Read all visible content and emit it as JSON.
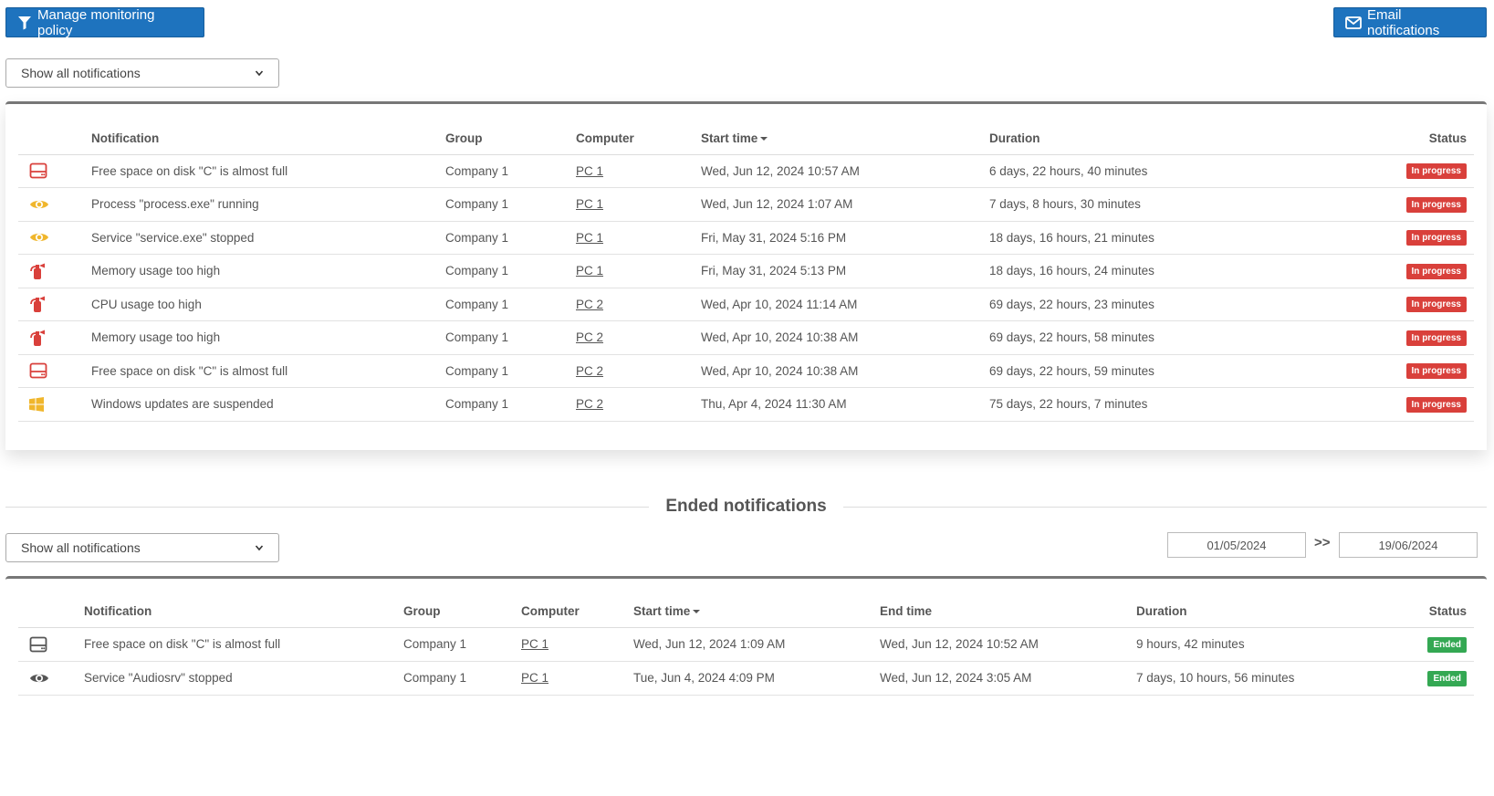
{
  "toolbar": {
    "manage_label": "Manage monitoring policy",
    "email_label": "Email notifications"
  },
  "active": {
    "filter": "Show all notifications",
    "columns": {
      "notification": "Notification",
      "group": "Group",
      "computer": "Computer",
      "start_time": "Start time",
      "duration": "Duration",
      "status": "Status"
    },
    "rows": [
      {
        "icon": "disk-icon",
        "notification": "Free space on disk \"C\" is almost full",
        "group": "Company 1",
        "computer": "PC 1",
        "start_time": "Wed, Jun 12, 2024 10:57 AM",
        "duration": "6 days, 22 hours, 40 minutes",
        "status": "In progress"
      },
      {
        "icon": "eye-icon",
        "notification": "Process \"process.exe\" running",
        "group": "Company 1",
        "computer": "PC 1",
        "start_time": "Wed, Jun 12, 2024 1:07 AM",
        "duration": "7 days, 8 hours, 30 minutes",
        "status": "In progress"
      },
      {
        "icon": "eye-icon",
        "notification": "Service \"service.exe\" stopped",
        "group": "Company 1",
        "computer": "PC 1",
        "start_time": "Fri, May 31, 2024 5:16 PM",
        "duration": "18 days, 16 hours, 21 minutes",
        "status": "In progress"
      },
      {
        "icon": "fire-extinguisher-icon",
        "notification": "Memory usage too high",
        "group": "Company 1",
        "computer": "PC 1",
        "start_time": "Fri, May 31, 2024 5:13 PM",
        "duration": "18 days, 16 hours, 24 minutes",
        "status": "In progress"
      },
      {
        "icon": "fire-extinguisher-icon",
        "notification": "CPU usage too high",
        "group": "Company 1",
        "computer": "PC 2",
        "start_time": "Wed, Apr 10, 2024 11:14 AM",
        "duration": "69 days, 22 hours, 23 minutes",
        "status": "In progress"
      },
      {
        "icon": "fire-extinguisher-icon",
        "notification": "Memory usage too high",
        "group": "Company 1",
        "computer": "PC 2",
        "start_time": "Wed, Apr 10, 2024 10:38 AM",
        "duration": "69 days, 22 hours, 58 minutes",
        "status": "In progress"
      },
      {
        "icon": "disk-icon",
        "notification": "Free space on disk \"C\" is almost full",
        "group": "Company 1",
        "computer": "PC 2",
        "start_time": "Wed, Apr 10, 2024 10:38 AM",
        "duration": "69 days, 22 hours, 59 minutes",
        "status": "In progress"
      },
      {
        "icon": "windows-icon",
        "notification": "Windows updates are suspended",
        "group": "Company 1",
        "computer": "PC 2",
        "start_time": "Thu, Apr 4, 2024 11:30 AM",
        "duration": "75 days, 22 hours, 7 minutes",
        "status": "In progress"
      }
    ]
  },
  "ended": {
    "heading": "Ended notifications",
    "filter": "Show all notifications",
    "date_from": "01/05/2024",
    "date_sep": ">>",
    "date_to": "19/06/2024",
    "columns": {
      "notification": "Notification",
      "group": "Group",
      "computer": "Computer",
      "start_time": "Start time",
      "end_time": "End time",
      "duration": "Duration",
      "status": "Status"
    },
    "rows": [
      {
        "icon": "disk-icon",
        "notification": "Free space on disk \"C\" is almost full",
        "group": "Company 1",
        "computer": "PC 1",
        "start_time": "Wed, Jun 12, 2024 1:09 AM",
        "end_time": "Wed, Jun 12, 2024 10:52 AM",
        "duration": "9 hours, 42 minutes",
        "status": "Ended"
      },
      {
        "icon": "eye-icon",
        "notification": "Service \"Audiosrv\" stopped",
        "group": "Company 1",
        "computer": "PC 1",
        "start_time": "Tue, Jun 4, 2024 4:09 PM",
        "end_time": "Wed, Jun 12, 2024 3:05 AM",
        "duration": "7 days, 10 hours, 56 minutes",
        "status": "Ended"
      }
    ]
  },
  "colors": {
    "primary": "#1e73be",
    "danger": "#d9403b",
    "success": "#34a853",
    "warning": "#f0b62c"
  }
}
